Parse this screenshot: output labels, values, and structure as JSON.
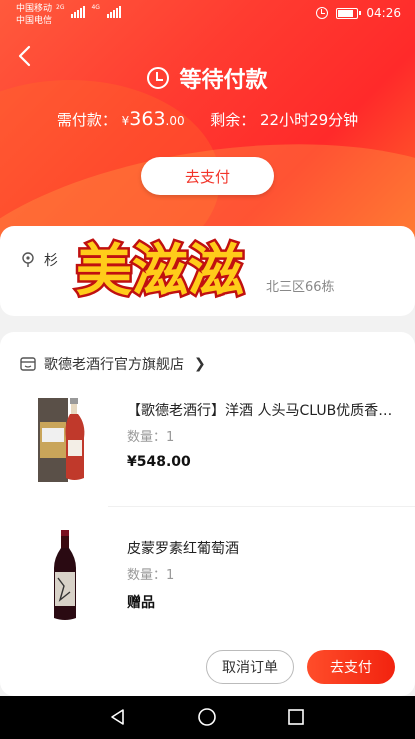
{
  "status_bar": {
    "carrier_1": "中国移动",
    "carrier_2": "中国电信",
    "net_1": "2G",
    "net_2": "4G",
    "time": "04:26",
    "battery_level": 0.85
  },
  "header": {
    "title": "等待付款",
    "amount_label": "需付款：",
    "currency": "¥",
    "amount_int": "363",
    "amount_dec": ".00",
    "remaining_label": "剩余：",
    "remaining_time": "22小时29分钟",
    "pay_button": "去支付"
  },
  "address": {
    "name_partial": "杉",
    "detail_partial": "北三区66栋",
    "watermark_text": "美滋滋"
  },
  "order": {
    "shop_name": "歌德老酒行官方旗舰店",
    "items": [
      {
        "title": "【歌德老酒行】洋酒 人头马CLUB优质香槟区干邑",
        "qty": "数量：1",
        "price": "¥548.00"
      },
      {
        "title": "皮蒙罗素红葡萄酒",
        "qty": "数量：1",
        "price": "赠品"
      }
    ],
    "cancel_button": "取消订单",
    "pay_button": "去支付"
  },
  "colors": {
    "accent": "#f2352a",
    "header_gradient_start": "#ff5a3c",
    "header_gradient_end": "#ff6a2a"
  }
}
